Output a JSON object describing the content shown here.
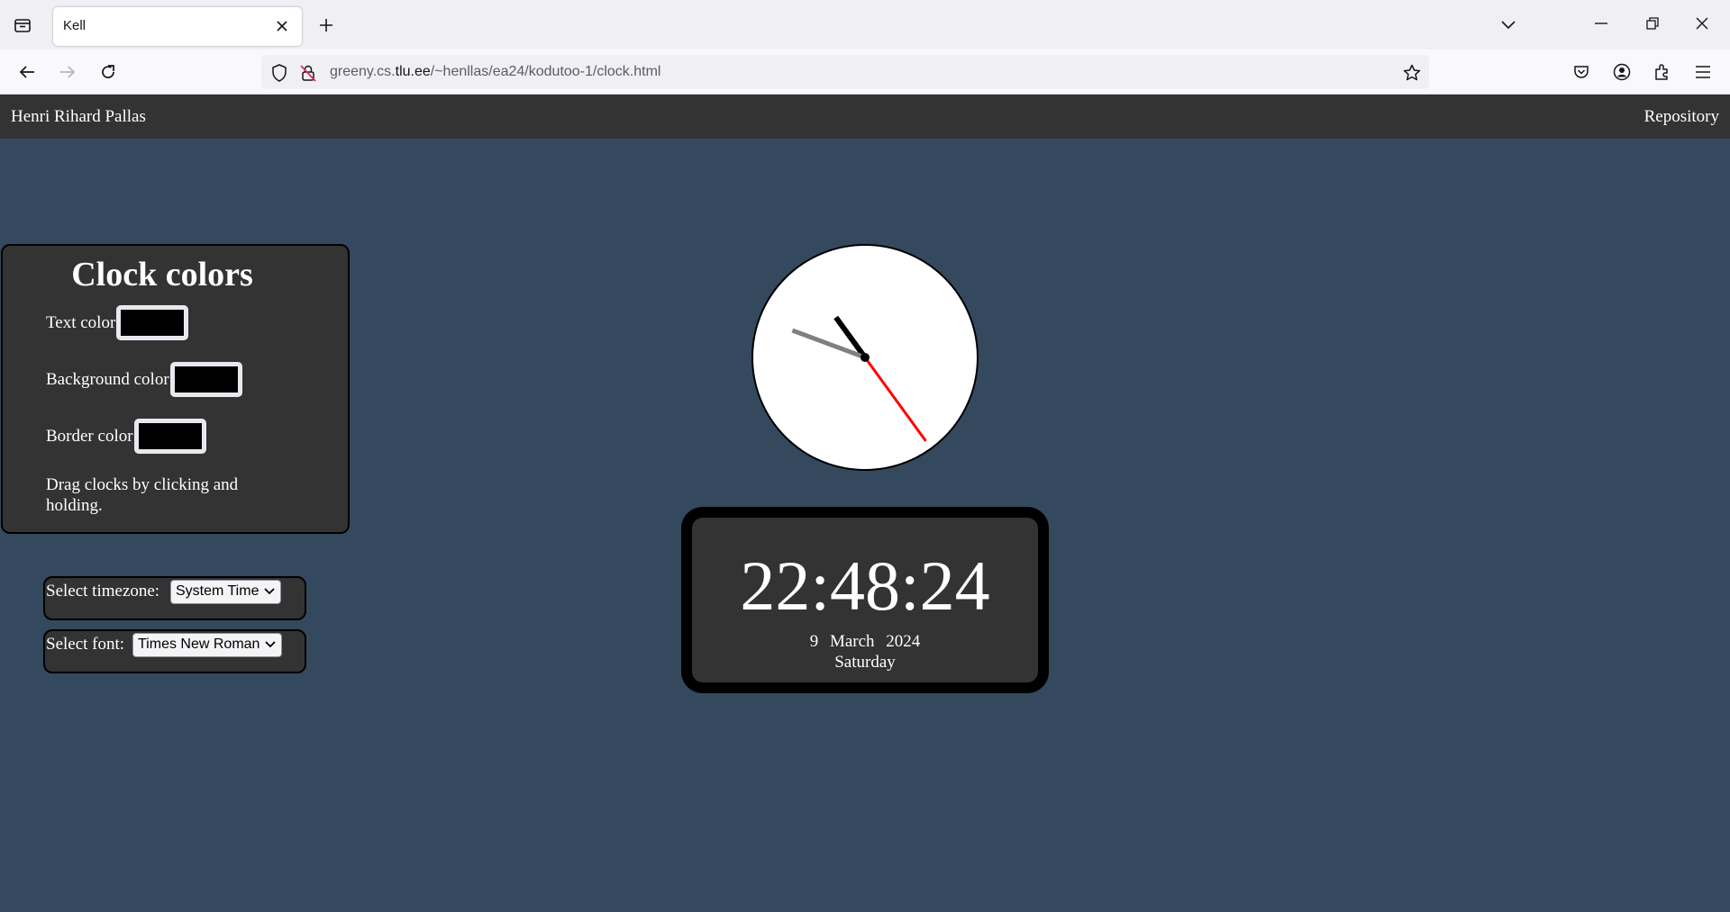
{
  "browser": {
    "tab_title": "Kell",
    "url_prefix": "greeny.cs.",
    "url_host": "tlu.ee",
    "url_path": "/~henllas/ea24/kodutoo-1/clock.html"
  },
  "header": {
    "author": "Henri Rihard Pallas",
    "repository_link": "Repository"
  },
  "colors_panel": {
    "title": "Clock colors",
    "text_color_label": "Text color",
    "background_color_label": "Background color",
    "border_color_label": "Border color",
    "text_color": "#000000",
    "background_color": "#000000",
    "border_color": "#000000",
    "drag_note": "Drag clocks by clicking and holding."
  },
  "timezone": {
    "label": "Select timezone:",
    "selected": "System Time"
  },
  "font": {
    "label": "Select font:",
    "selected": "Times New Roman"
  },
  "clock": {
    "time": "22:48:24",
    "day": "9",
    "month": "March",
    "year": "2024",
    "weekday": "Saturday",
    "hours": 22,
    "minutes": 48,
    "seconds": 24
  },
  "colors": {
    "page_background": "#34495e",
    "panel_background": "#333333",
    "second_hand": "#ff0000",
    "minute_hand": "#808080",
    "hour_hand": "#000000"
  }
}
